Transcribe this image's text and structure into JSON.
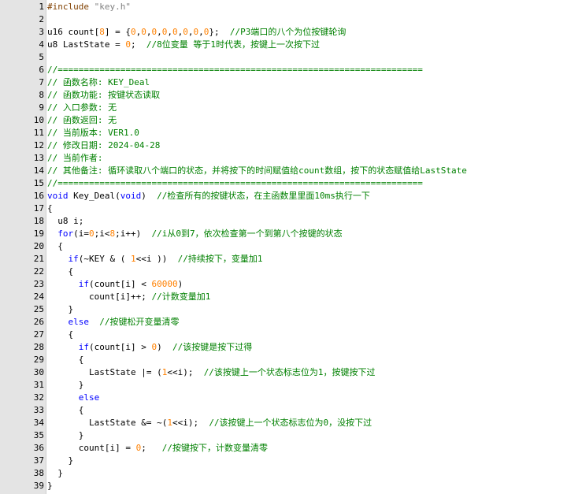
{
  "editor": {
    "colors": {
      "keyword": "#0000ff",
      "comment": "#008000",
      "number": "#ff8000",
      "string": "#808080",
      "preprocessor": "#804000",
      "gutter": "#e4e4e4"
    },
    "lines": [
      {
        "n": "1",
        "t": "#include \"key.h\""
      },
      {
        "n": "2",
        "t": ""
      },
      {
        "n": "3",
        "t": "u16 count[8] = {0,0,0,0,0,0,0,0};  //P3端口的八个为位按键轮询"
      },
      {
        "n": "4",
        "t": "u8 LastState = 0;  //8位变量 等于1时代表，按键上一次按下过"
      },
      {
        "n": "5",
        "t": ""
      },
      {
        "n": "6",
        "t": "//======================================================================"
      },
      {
        "n": "7",
        "t": "// 函数名称: KEY_Deal"
      },
      {
        "n": "8",
        "t": "// 函数功能: 按键状态读取"
      },
      {
        "n": "9",
        "t": "// 入口参数: 无"
      },
      {
        "n": "10",
        "t": "// 函数返回: 无"
      },
      {
        "n": "11",
        "t": "// 当前版本: VER1.0"
      },
      {
        "n": "12",
        "t": "// 修改日期: 2024-04-28"
      },
      {
        "n": "13",
        "t": "// 当前作者:"
      },
      {
        "n": "14",
        "t": "// 其他备注: 循环读取八个端口的状态，并将按下的时间赋值给count数组，按下的状态赋值给LastState"
      },
      {
        "n": "15",
        "t": "//======================================================================"
      },
      {
        "n": "16",
        "t": "void Key_Deal(void)  //检查所有的按键状态，在主函数里里面10ms执行一下"
      },
      {
        "n": "17",
        "t": "{"
      },
      {
        "n": "18",
        "t": "  u8 i;"
      },
      {
        "n": "19",
        "t": "  for(i=0;i<8;i++)  //i从0到7，依次检查第一个到第八个按键的状态"
      },
      {
        "n": "20",
        "t": "  {"
      },
      {
        "n": "21",
        "t": "    if(~KEY & ( 1<<i ))  //持续按下，变量加1"
      },
      {
        "n": "22",
        "t": "    {"
      },
      {
        "n": "23",
        "t": "      if(count[i] < 60000)"
      },
      {
        "n": "24",
        "t": "        count[i]++; //计数变量加1"
      },
      {
        "n": "25",
        "t": "    }"
      },
      {
        "n": "26",
        "t": "    else  //按键松开变量清零"
      },
      {
        "n": "27",
        "t": "    {"
      },
      {
        "n": "28",
        "t": "      if(count[i] > 0)  //该按键是按下过得"
      },
      {
        "n": "29",
        "t": "      {"
      },
      {
        "n": "30",
        "t": "        LastState |= (1<<i);  //该按键上一个状态标志位为1，按键按下过"
      },
      {
        "n": "31",
        "t": "      }"
      },
      {
        "n": "32",
        "t": "      else"
      },
      {
        "n": "33",
        "t": "      {"
      },
      {
        "n": "34",
        "t": "        LastState &= ~(1<<i);  //该按键上一个状态标志位为0，没按下过"
      },
      {
        "n": "35",
        "t": "      }"
      },
      {
        "n": "36",
        "t": "      count[i] = 0;   //按键按下，计数变量清零"
      },
      {
        "n": "37",
        "t": "    }"
      },
      {
        "n": "38",
        "t": "  }"
      },
      {
        "n": "39",
        "t": "}"
      }
    ]
  }
}
